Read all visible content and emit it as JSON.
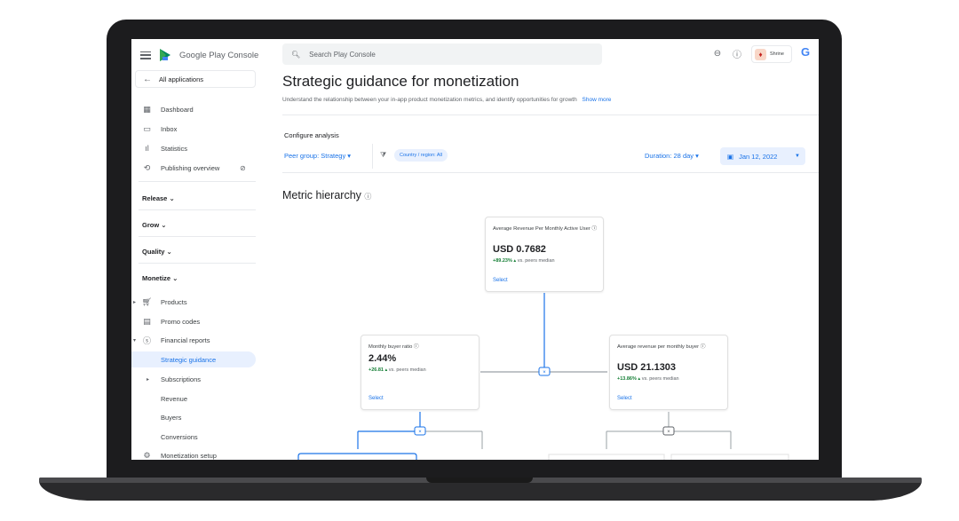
{
  "app": {
    "name_google": "Google Play",
    "name_console": "Console"
  },
  "sidebar": {
    "all_apps": "All applications",
    "items": [
      {
        "label": "Dashboard",
        "icon": "dashboard-icon"
      },
      {
        "label": "Inbox",
        "icon": "inbox-icon"
      },
      {
        "label": "Statistics",
        "icon": "statistics-icon"
      },
      {
        "label": "Publishing overview",
        "icon": "publishing-icon"
      }
    ],
    "sections": [
      {
        "label": "Release ⌄"
      },
      {
        "label": "Grow ⌄"
      },
      {
        "label": "Quality ⌄"
      },
      {
        "label": "Monetize ⌄"
      }
    ],
    "monetize_items": [
      {
        "label": "Products"
      },
      {
        "label": "Promo codes"
      },
      {
        "label": "Financial reports"
      },
      {
        "label": "Strategic guidance"
      },
      {
        "label": "Subscriptions"
      },
      {
        "label": "Revenue"
      },
      {
        "label": "Buyers"
      },
      {
        "label": "Conversions"
      },
      {
        "label": "Monetization setup"
      }
    ]
  },
  "topbar": {
    "search_placeholder": "Search Play Console",
    "account_name": "Shrine"
  },
  "page": {
    "title": "Strategic guidance for monetization",
    "subtitle": "Understand the relationship between your in-app product monetization metrics, and identify opportunities for growth",
    "show_more": "Show more",
    "configure": "Configure analysis",
    "peer_group": "Peer group: Strategy ▾",
    "country_chip": "Country / region: All",
    "duration": "Duration: 28 day ▾",
    "date": "Jan 12, 2022",
    "hierarchy_title": "Metric hierarchy"
  },
  "cards": {
    "arpmau": {
      "label": "Average Revenue Per Monthly Active User",
      "value": "USD 0.7682",
      "change": "+89.23% ▴",
      "compare": "vs. peers median",
      "select": "Select"
    },
    "buyer_ratio": {
      "label": "Monthly buyer ratio",
      "value": "2.44%",
      "change": "+26.81 ▴",
      "compare": "vs. peers median",
      "select": "Select"
    },
    "arpmb": {
      "label": "Average revenue per monthly buyer",
      "value": "USD 21.1303",
      "change": "+13.86% ▴",
      "compare": "vs. peers median",
      "select": "Select"
    }
  },
  "colors": {
    "accent": "#1a73e8",
    "positive": "#188038",
    "active_bg": "#e8f0fe"
  }
}
